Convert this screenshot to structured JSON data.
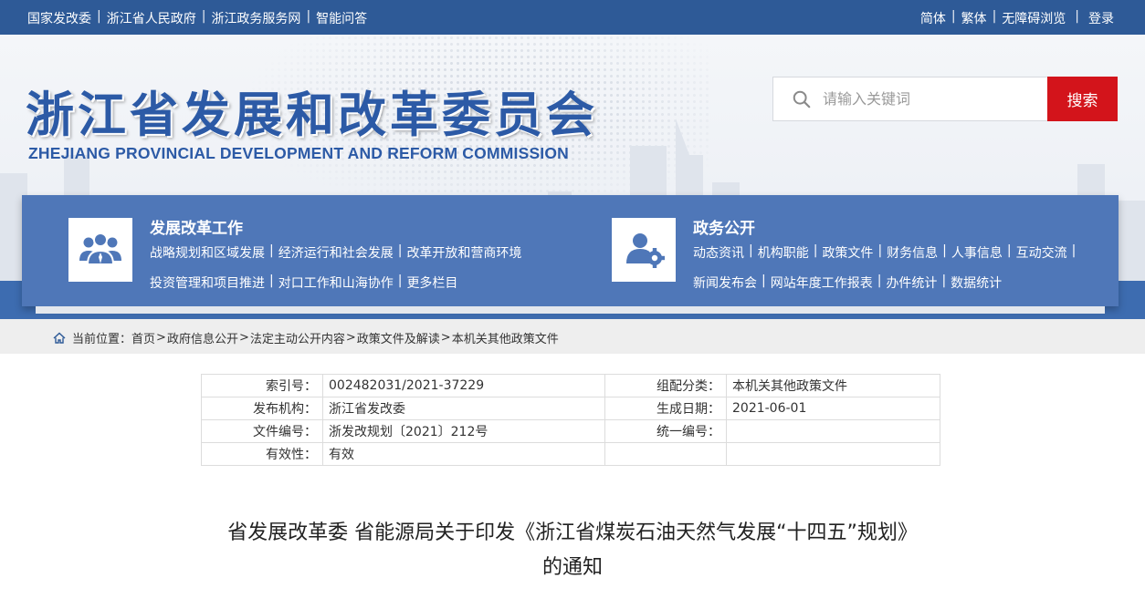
{
  "topbar": {
    "left_links": [
      "国家发改委",
      "浙江省人民政府",
      "浙江政务服务网",
      "智能问答"
    ],
    "right_links": [
      "简体",
      "繁体",
      "无障碍浏览",
      "登录"
    ]
  },
  "header": {
    "title": "浙江省发展和改革委员会",
    "subtitle": "ZHEJIANG PROVINCIAL DEVELOPMENT AND REFORM COMMISSION",
    "search_placeholder": "请输入关键词",
    "search_button": "搜索"
  },
  "nav": {
    "groups": [
      {
        "icon": "people-group-icon",
        "title": "发展改革工作",
        "rows": [
          [
            "战略规划和区域发展",
            "经济运行和社会发展",
            "改革开放和营商环境"
          ],
          [
            "投资管理和项目推进",
            "对口工作和山海协作",
            "更多栏目"
          ]
        ]
      },
      {
        "icon": "user-gear-icon",
        "title": "政务公开",
        "rows": [
          [
            "动态资讯",
            "机构职能",
            "政策文件",
            "财务信息",
            "人事信息",
            "互动交流"
          ],
          [
            "新闻发布会",
            "网站年度工作报表",
            "办件统计",
            "数据统计"
          ]
        ]
      }
    ]
  },
  "breadcrumb": {
    "prefix": "当前位置：",
    "items": [
      "首页",
      "政府信息公开",
      "法定主动公开内容",
      "政策文件及解读",
      "本机关其他政策文件"
    ]
  },
  "meta": {
    "rows": [
      {
        "k1": "索引号：",
        "v1": "002482031/2021-37229",
        "k2": "组配分类：",
        "v2": "本机关其他政策文件"
      },
      {
        "k1": "发布机构：",
        "v1": "浙江省发改委",
        "k2": "生成日期：",
        "v2": "2021-06-01"
      },
      {
        "k1": "文件编号：",
        "v1": "浙发改规划〔2021〕212号",
        "k2": "统一编号：",
        "v2": ""
      },
      {
        "k1": "有效性：",
        "v1": "有效",
        "k2": "",
        "v2": ""
      }
    ]
  },
  "document": {
    "title_line1": "省发展改革委 省能源局关于印发《浙江省煤炭石油天然气发展“十四五”规划》",
    "title_line2": "的通知"
  },
  "colors": {
    "topbar": "#2e5a97",
    "brand_blue": "#2c5aa6",
    "nav_panel": "#4f77b8",
    "search_button": "#d3141b"
  }
}
